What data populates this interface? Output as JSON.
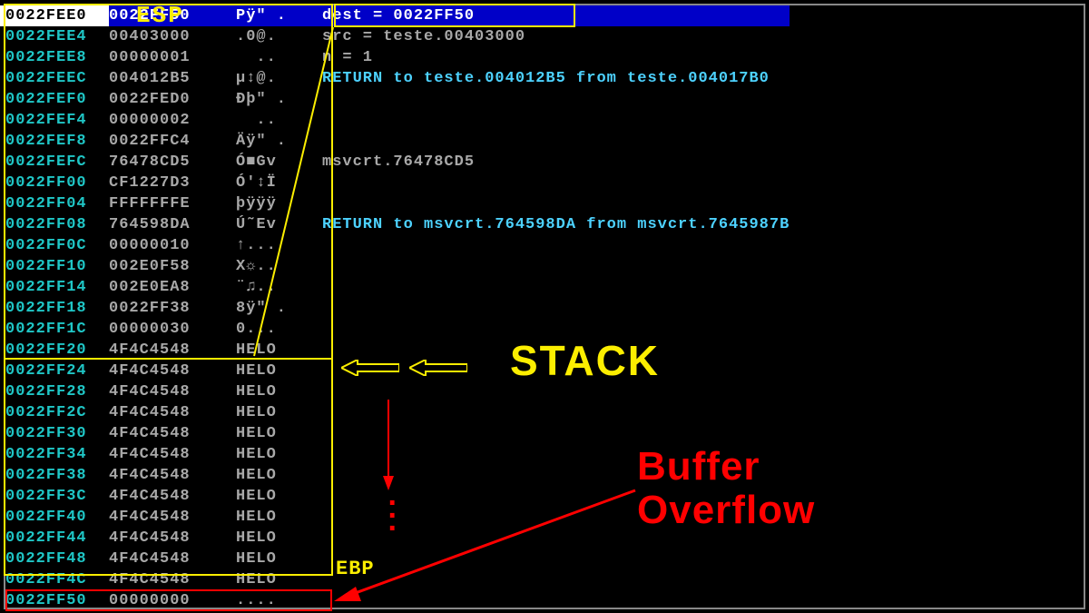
{
  "labels": {
    "esp": "ESP",
    "ebp": "EBP",
    "stack": "STACK",
    "buffer": "Buffer\nOverflow"
  },
  "stack": [
    {
      "addr": "0022FEE0",
      "val": "0022FF50",
      "asc": "Pÿ\" .",
      "note": "dest = 0022FF50",
      "hl": true
    },
    {
      "addr": "0022FEE4",
      "val": "00403000",
      "asc": ".0@.",
      "note": "src = teste.00403000",
      "noteClass": ""
    },
    {
      "addr": "0022FEE8",
      "val": "00000001",
      "asc": "  ..",
      "note": "n = 1",
      "noteClass": ""
    },
    {
      "addr": "0022FEEC",
      "val": "004012B5",
      "asc": "µ↕@.",
      "note": "RETURN to teste.004012B5 from teste.004017B0",
      "noteClass": "cyan"
    },
    {
      "addr": "0022FEF0",
      "val": "0022FED0",
      "asc": "Ðþ\" .",
      "note": ""
    },
    {
      "addr": "0022FEF4",
      "val": "00000002",
      "asc": "  ..",
      "note": ""
    },
    {
      "addr": "0022FEF8",
      "val": "0022FFC4",
      "asc": "Äÿ\" .",
      "note": ""
    },
    {
      "addr": "0022FEFC",
      "val": "76478CD5",
      "asc": "Ó■Gv",
      "note": "msvcrt.76478CD5",
      "noteClass": ""
    },
    {
      "addr": "0022FF00",
      "val": "CF1227D3",
      "asc": "Ó'↕Ï",
      "note": ""
    },
    {
      "addr": "0022FF04",
      "val": "FFFFFFFE",
      "asc": "þÿÿÿ",
      "note": ""
    },
    {
      "addr": "0022FF08",
      "val": "764598DA",
      "asc": "Ú˜Ev",
      "note": "RETURN to msvcrt.764598DA from msvcrt.7645987B",
      "noteClass": "cyan"
    },
    {
      "addr": "0022FF0C",
      "val": "00000010",
      "asc": "↑...",
      "note": ""
    },
    {
      "addr": "0022FF10",
      "val": "002E0F58",
      "asc": "X☼..",
      "note": ""
    },
    {
      "addr": "0022FF14",
      "val": "002E0EA8",
      "asc": "¨♫..",
      "note": ""
    },
    {
      "addr": "0022FF18",
      "val": "0022FF38",
      "asc": "8ÿ\" .",
      "note": ""
    },
    {
      "addr": "0022FF1C",
      "val": "00000030",
      "asc": "0...",
      "note": ""
    },
    {
      "addr": "0022FF20",
      "val": "4F4C4548",
      "asc": "HELO",
      "note": ""
    },
    {
      "addr": "0022FF24",
      "val": "4F4C4548",
      "asc": "HELO",
      "note": ""
    },
    {
      "addr": "0022FF28",
      "val": "4F4C4548",
      "asc": "HELO",
      "note": ""
    },
    {
      "addr": "0022FF2C",
      "val": "4F4C4548",
      "asc": "HELO",
      "note": ""
    },
    {
      "addr": "0022FF30",
      "val": "4F4C4548",
      "asc": "HELO",
      "note": ""
    },
    {
      "addr": "0022FF34",
      "val": "4F4C4548",
      "asc": "HELO",
      "note": ""
    },
    {
      "addr": "0022FF38",
      "val": "4F4C4548",
      "asc": "HELO",
      "note": ""
    },
    {
      "addr": "0022FF3C",
      "val": "4F4C4548",
      "asc": "HELO",
      "note": ""
    },
    {
      "addr": "0022FF40",
      "val": "4F4C4548",
      "asc": "HELO",
      "note": ""
    },
    {
      "addr": "0022FF44",
      "val": "4F4C4548",
      "asc": "HELO",
      "note": ""
    },
    {
      "addr": "0022FF48",
      "val": "4F4C4548",
      "asc": "HELO",
      "note": ""
    },
    {
      "addr": "0022FF4C",
      "val": "4F4C4548",
      "asc": "HELO",
      "note": ""
    },
    {
      "addr": "0022FF50",
      "val": "00000000",
      "asc": "....",
      "note": ""
    }
  ]
}
